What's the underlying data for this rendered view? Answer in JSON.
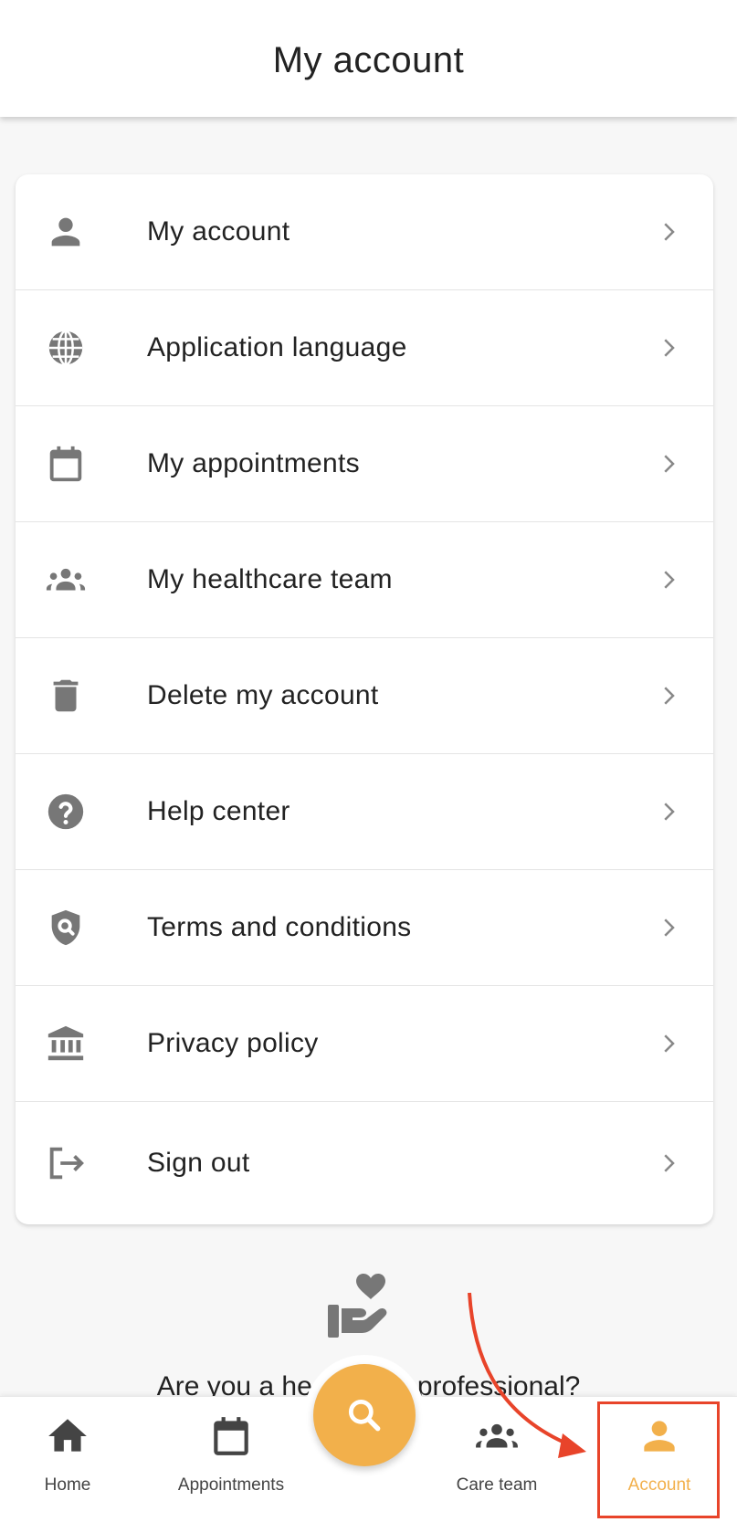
{
  "header": {
    "title": "My account"
  },
  "menu": {
    "items": [
      {
        "label": "My account",
        "icon": "person-icon"
      },
      {
        "label": "Application language",
        "icon": "globe-icon"
      },
      {
        "label": "My appointments",
        "icon": "calendar-icon"
      },
      {
        "label": "My healthcare team",
        "icon": "group-icon"
      },
      {
        "label": "Delete my account",
        "icon": "trash-icon"
      },
      {
        "label": "Help center",
        "icon": "help-icon"
      },
      {
        "label": "Terms and conditions",
        "icon": "shield-search-icon"
      },
      {
        "label": "Privacy policy",
        "icon": "bank-icon"
      },
      {
        "label": "Sign out",
        "icon": "logout-icon"
      }
    ]
  },
  "promo": {
    "icon": "heart-hand-icon",
    "text": "Are you a healthcare professional?"
  },
  "bottom_nav": {
    "items": [
      {
        "label": "Home",
        "icon": "home-icon",
        "active": false
      },
      {
        "label": "Appointments",
        "icon": "calendar-icon",
        "active": false
      },
      {
        "label": "Care team",
        "icon": "group-icon",
        "active": false
      },
      {
        "label": "Account",
        "icon": "person-icon",
        "active": true
      }
    ],
    "fab_icon": "search-icon"
  },
  "colors": {
    "accent": "#f2b04b",
    "icon_gray": "#777777",
    "annotation_red": "#e8442a"
  }
}
